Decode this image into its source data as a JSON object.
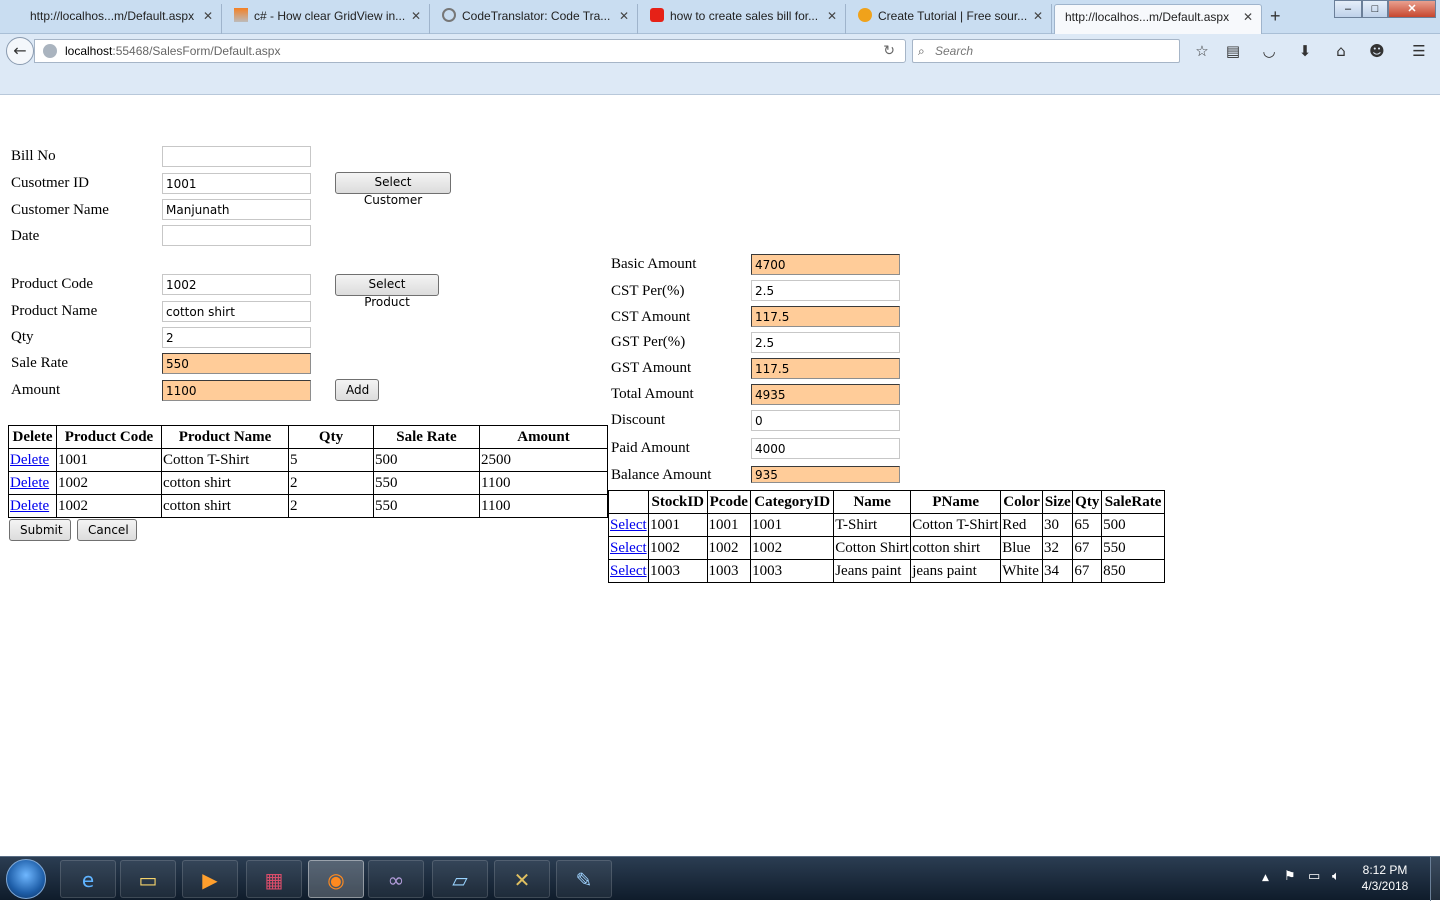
{
  "browser": {
    "tabs": [
      {
        "title": "http://localhos...m/Default.aspx",
        "favicon": "blank"
      },
      {
        "title": "c# - How clear GridView in...",
        "favicon": "stackoverflow"
      },
      {
        "title": "CodeTranslator: Code Tra...",
        "favicon": "telerik"
      },
      {
        "title": "how to create sales bill for...",
        "favicon": "youtube"
      },
      {
        "title": "Create Tutorial | Free sour...",
        "favicon": "tutorial"
      },
      {
        "title": "http://localhos...m/Default.aspx",
        "favicon": "blank",
        "active": true
      }
    ],
    "new_tab": "+",
    "window_buttons": {
      "minimize": "–",
      "maximize": "□",
      "close": "✕"
    },
    "url_host": "localhost",
    "url_path": ":55468/SalesForm/Default.aspx",
    "search_placeholder": "Search",
    "toolbar_icons": [
      "star-icon",
      "reading-list-icon",
      "pocket-icon",
      "download-icon",
      "home-icon",
      "smiley-icon",
      "menu-icon"
    ]
  },
  "form": {
    "bill_no": {
      "label": "Bill No",
      "value": ""
    },
    "customer_id": {
      "label": "Cusotmer ID",
      "value": "1001"
    },
    "customer_name": {
      "label": "Customer Name",
      "value": "Manjunath"
    },
    "date": {
      "label": "Date",
      "value": ""
    },
    "select_customer_label": "Select Customer",
    "product_code": {
      "label": "Product Code",
      "value": "1002"
    },
    "product_name": {
      "label": "Product Name",
      "value": "cotton shirt"
    },
    "qty": {
      "label": "Qty",
      "value": "2"
    },
    "sale_rate": {
      "label": "Sale Rate",
      "value": "550"
    },
    "amount": {
      "label": "Amount",
      "value": "1100"
    },
    "select_product_label": "Select Product",
    "add_label": "Add",
    "submit_label": "Submit",
    "cancel_label": "Cancel"
  },
  "summary": {
    "basic_amount": {
      "label": "Basic Amount",
      "value": "4700"
    },
    "cst_per": {
      "label": "CST Per(%)",
      "value": "2.5"
    },
    "cst_amount": {
      "label": "CST Amount",
      "value": "117.5"
    },
    "gst_per": {
      "label": "GST Per(%)",
      "value": "2.5"
    },
    "gst_amount": {
      "label": "GST Amount",
      "value": "117.5"
    },
    "total_amount": {
      "label": "Total Amount",
      "value": "4935"
    },
    "discount": {
      "label": "Discount",
      "value": "0"
    },
    "paid_amount": {
      "label": "Paid Amount",
      "value": "4000"
    },
    "balance_amount": {
      "label": "Balance Amount",
      "value": "935"
    }
  },
  "bill_grid": {
    "headers": [
      "Delete",
      "Product Code",
      "Product Name",
      "Qty",
      "Sale Rate",
      "Amount"
    ],
    "rows": [
      {
        "action": "Delete",
        "code": "1001",
        "name": "Cotton T-Shirt",
        "qty": "5",
        "rate": "500",
        "amount": "2500"
      },
      {
        "action": "Delete",
        "code": "1002",
        "name": "cotton shirt",
        "qty": "2",
        "rate": "550",
        "amount": "1100"
      },
      {
        "action": "Delete",
        "code": "1002",
        "name": "cotton shirt",
        "qty": "2",
        "rate": "550",
        "amount": "1100"
      }
    ]
  },
  "stock_grid": {
    "headers": [
      "",
      "StockID",
      "Pcode",
      "CategoryID",
      "Name",
      "PName",
      "Color",
      "Size",
      "Qty",
      "SaleRate"
    ],
    "rows": [
      {
        "action": "Select",
        "stock_id": "1001",
        "pcode": "1001",
        "category_id": "1001",
        "name": "T-Shirt",
        "pname": "Cotton T-Shirt",
        "color": "Red",
        "size": "30",
        "qty": "65",
        "sale_rate": "500"
      },
      {
        "action": "Select",
        "stock_id": "1002",
        "pcode": "1002",
        "category_id": "1002",
        "name": "Cotton Shirt",
        "pname": "cotton shirt",
        "color": "Blue",
        "size": "32",
        "qty": "67",
        "sale_rate": "550"
      },
      {
        "action": "Select",
        "stock_id": "1003",
        "pcode": "1003",
        "category_id": "1003",
        "name": "Jeans paint",
        "pname": "jeans paint",
        "color": "White",
        "size": "34",
        "qty": "67",
        "sale_rate": "850"
      }
    ]
  },
  "taskbar": {
    "items": [
      "ie-icon",
      "explorer-icon",
      "media-player-icon",
      "winrar-icon",
      "firefox-icon",
      "visual-studio-icon",
      "notepad-icon",
      "tools-icon",
      "paint-icon"
    ],
    "clock_time": "8:12 PM",
    "clock_date": "4/3/2018"
  }
}
